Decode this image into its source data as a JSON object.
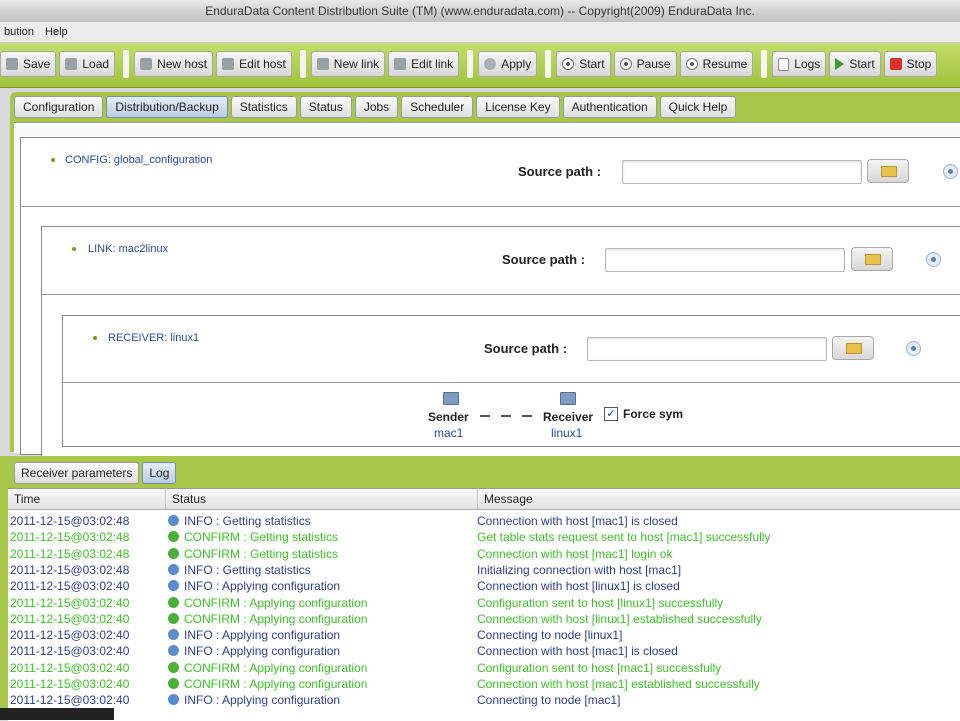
{
  "window": {
    "title": "EnduraData Content Distribution Suite (TM) (www.enduradata.com) -- Copyright(2009) EnduraData Inc."
  },
  "menu": {
    "items": [
      "bution",
      "Help"
    ]
  },
  "toolbar": {
    "save": "Save",
    "load": "Load",
    "new_host": "New host",
    "edit_host": "Edit host",
    "new_link": "New link",
    "edit_link": "Edit link",
    "apply": "Apply",
    "start": "Start",
    "pause": "Pause",
    "resume": "Resume",
    "logs": "Logs",
    "start2": "Start",
    "stop": "Stop"
  },
  "tabs": [
    "Configuration",
    "Distribution/Backup",
    "Statistics",
    "Status",
    "Jobs",
    "Scheduler",
    "License Key",
    "Authentication",
    "Quick Help"
  ],
  "active_tab": "Distribution/Backup",
  "tree": {
    "config": {
      "label": "CONFIG: global_configuration",
      "source_path_label": "Source path :",
      "source_path_value": ""
    },
    "link": {
      "label": "LINK: mac2linux",
      "source_path_label": "Source path :",
      "source_path_value": ""
    },
    "receiver": {
      "label": "RECEIVER: linux1",
      "source_path_label": "Source path :",
      "source_path_value": ""
    },
    "connection": {
      "sender_label": "Sender",
      "sender_host": "mac1",
      "receiver_label": "Receiver",
      "receiver_host": "linux1",
      "force_sym_label": "Force sym",
      "force_sym_checked": true
    }
  },
  "bottom_tabs": [
    "Receiver parameters",
    "Log"
  ],
  "bottom_active": "Log",
  "log": {
    "columns": [
      "Time",
      "Status",
      "Message"
    ],
    "rows": [
      {
        "time": "2011-12-15@03:02:48",
        "type": "info",
        "status": "INFO : Getting statistics",
        "message": "Connection with host [mac1] is closed"
      },
      {
        "time": "2011-12-15@03:02:48",
        "type": "confirm",
        "status": "CONFIRM : Getting statistics",
        "message": "Get table stats request sent to host [mac1] successfully"
      },
      {
        "time": "2011-12-15@03:02:48",
        "type": "confirm",
        "status": "CONFIRM : Getting statistics",
        "message": "Connection with host [mac1] login ok"
      },
      {
        "time": "2011-12-15@03:02:48",
        "type": "info",
        "status": "INFO : Getting statistics",
        "message": "Initializing connection with host [mac1]"
      },
      {
        "time": "2011-12-15@03:02:40",
        "type": "info",
        "status": "INFO : Applying configuration",
        "message": "Connection with host [linux1] is closed"
      },
      {
        "time": "2011-12-15@03:02:40",
        "type": "confirm",
        "status": "CONFIRM : Applying configuration",
        "message": "Configuration sent to host [linux1] successfully"
      },
      {
        "time": "2011-12-15@03:02:40",
        "type": "confirm",
        "status": "CONFIRM : Applying configuration",
        "message": "Connection with host [linux1] established successfully"
      },
      {
        "time": "2011-12-15@03:02:40",
        "type": "info",
        "status": "INFO : Applying configuration",
        "message": "Connecting to node [linux1]"
      },
      {
        "time": "2011-12-15@03:02:40",
        "type": "info",
        "status": "INFO : Applying configuration",
        "message": "Connection with host [mac1] is closed"
      },
      {
        "time": "2011-12-15@03:02:40",
        "type": "confirm",
        "status": "CONFIRM : Applying configuration",
        "message": "Configuration sent to host [mac1] successfully"
      },
      {
        "time": "2011-12-15@03:02:40",
        "type": "confirm",
        "status": "CONFIRM : Applying configuration",
        "message": "Connection with host [mac1] established successfully"
      },
      {
        "time": "2011-12-15@03:02:40",
        "type": "info",
        "status": "INFO : Applying configuration",
        "message": "Connecting to node [mac1]"
      }
    ]
  },
  "colors": {
    "toolbar_green": "#a9c84b",
    "info_text": "#2c3f8a",
    "confirm_text": "#3fbf2a"
  }
}
